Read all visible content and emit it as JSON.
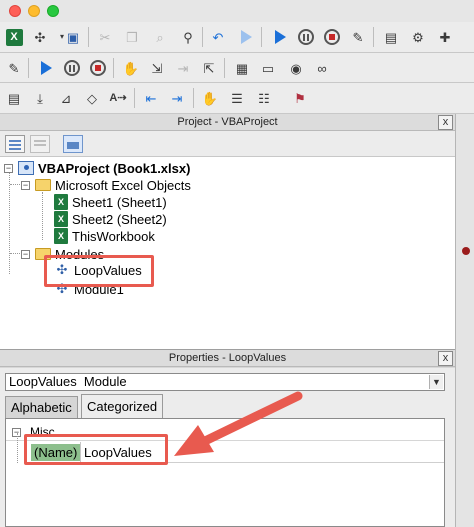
{
  "toolbar_icons": {
    "row1": [
      "excel-icon",
      "insert-icon",
      "save-icon",
      "cut-icon",
      "copy-icon",
      "paste-icon",
      "find-icon",
      "find-next-icon",
      "undo-icon",
      "redo-icon",
      "run-icon",
      "break-icon",
      "reset-icon",
      "design-mode-icon",
      "project-explorer-icon",
      "properties-icon",
      "object-browser-icon",
      "toolbox-icon"
    ],
    "row2": [
      "design-mode-icon",
      "run-icon",
      "break-icon",
      "reset-icon",
      "toggle-breakpoint-icon",
      "step-into-icon",
      "step-over-icon",
      "step-out-icon",
      "locals-window-icon",
      "immediate-window-icon",
      "watch-window-icon",
      "quick-watch-icon"
    ],
    "row3": [
      "list-properties-icon",
      "list-constants-icon",
      "quick-info-icon",
      "parameter-info-icon",
      "complete-word-icon",
      "indent-icon",
      "outdent-icon",
      "toggle-breakpoint-icon",
      "comment-block-icon",
      "uncomment-block-icon",
      "clear-bookmarks-icon"
    ]
  },
  "project_panel": {
    "title": "Project - VBAProject",
    "close": "x",
    "tree": {
      "root": "VBAProject (Book1.xlsx)",
      "excel_objects": "Microsoft Excel Objects",
      "sheets": [
        "Sheet1 (Sheet1)",
        "Sheet2 (Sheet2)",
        "ThisWorkbook"
      ],
      "modules_folder": "Modules",
      "modules": [
        "LoopValues",
        "Module1"
      ]
    }
  },
  "properties_panel": {
    "title": "Properties - LoopValues",
    "close": "x",
    "object_combo": "LoopValues  Module",
    "tabs": [
      "Alphabetic",
      "Categorized"
    ],
    "active_tab": "Categorized",
    "category": "Misc",
    "property": {
      "name": "(Name)",
      "value": "LoopValues"
    }
  },
  "annotation_color": "#e85a4f"
}
